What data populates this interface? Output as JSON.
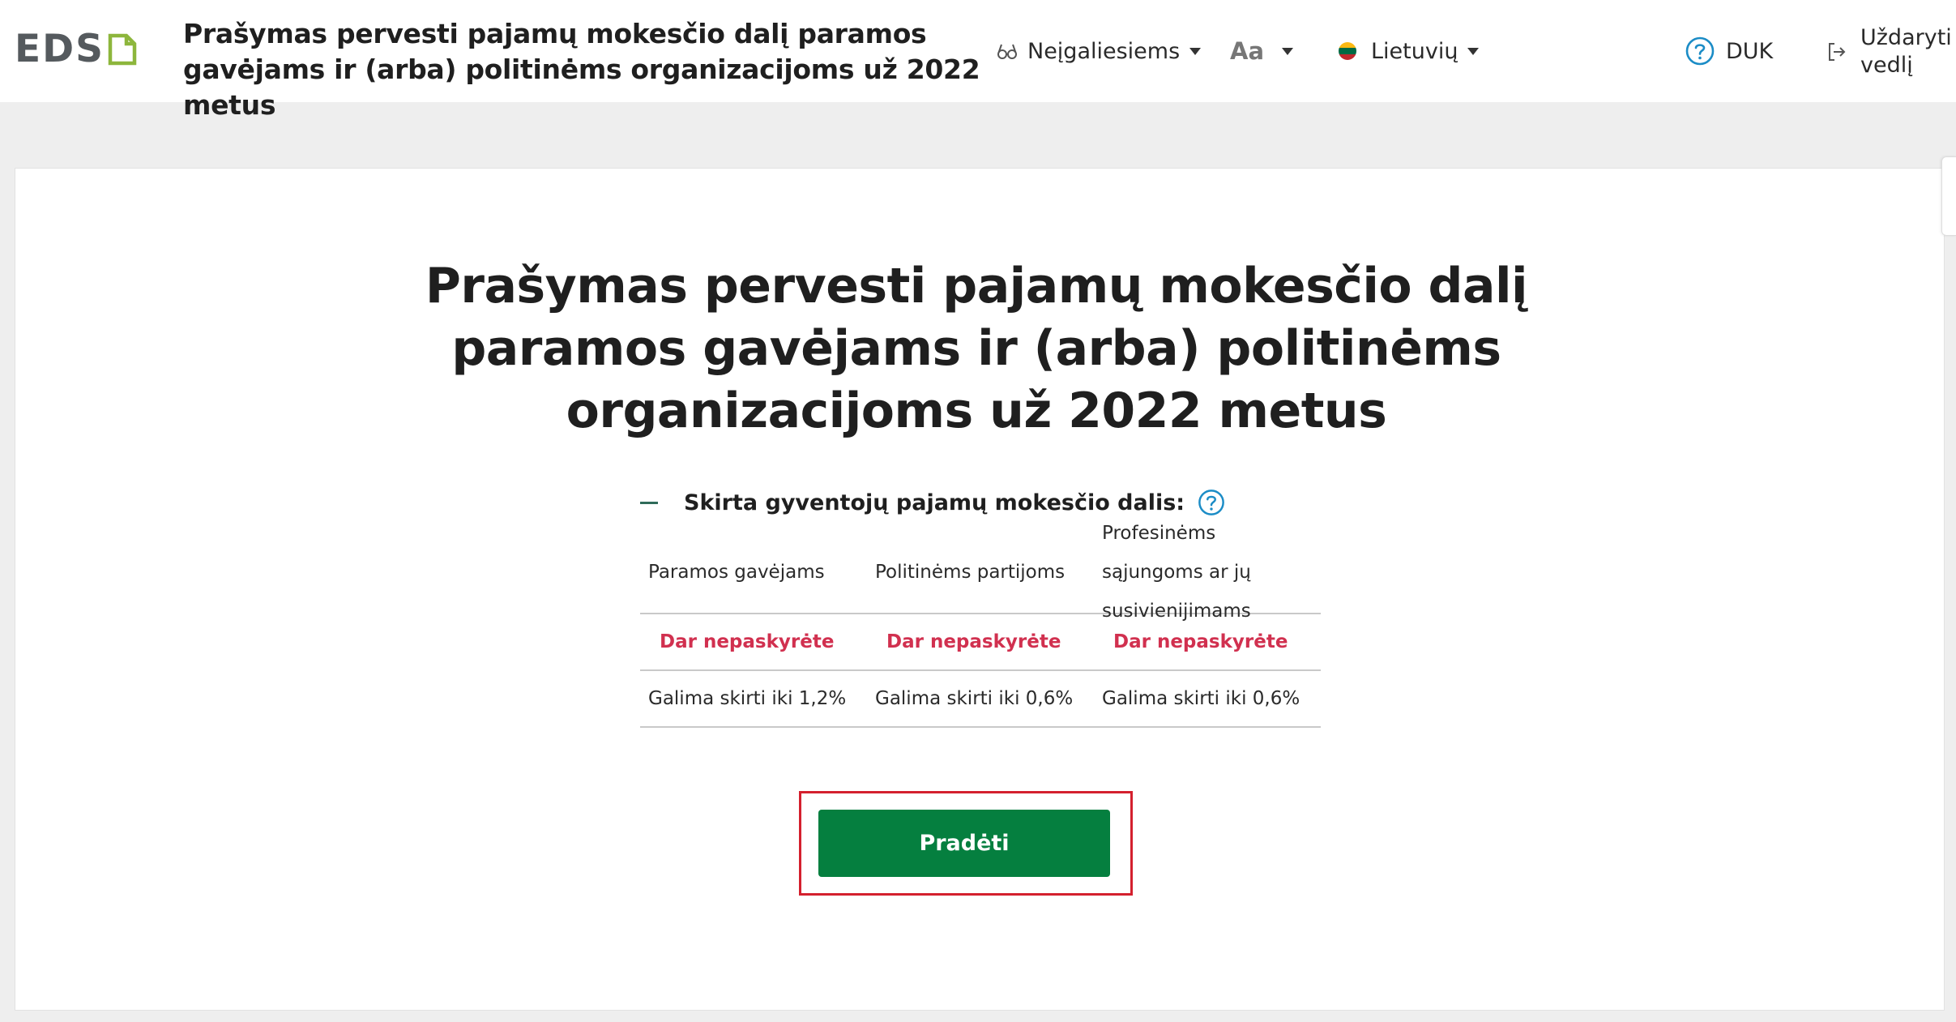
{
  "header": {
    "logo_text": "EDS",
    "title": "Prašymas pervesti pajamų mokesčio dalį paramos gavėjams ir (arba) politinėms organizacijoms už 2022 metus",
    "accessibility_label": "Neįgaliesiems",
    "font_size_label": "Aa",
    "language_label": "Lietuvių",
    "faq_label": "DUK",
    "close_label": "Uždaryti vedlį",
    "flag_colors": [
      "#fdb913",
      "#006a44",
      "#c1272d"
    ]
  },
  "main": {
    "title": "Prašymas pervesti pajamų mokesčio dalį paramos gavėjams ir (arba) politinėms organizacijoms už 2022 metus",
    "section_label": "Skirta gyventojų pajamų mokesčio dalis:",
    "columns": [
      "Paramos gavėjams",
      "Politinėms partijoms",
      "Profesinėms sąjungoms ar jų susivienijimams"
    ],
    "status_row": [
      "Dar nepaskyrėte",
      "Dar nepaskyrėte",
      "Dar nepaskyrėte"
    ],
    "limit_row": [
      "Galima skirti iki 1,2%",
      "Galima skirti iki 0,6%",
      "Galima skirti iki 0,6%"
    ],
    "start_button": "Pradėti"
  },
  "colors": {
    "accent_green": "#057f3f",
    "status_red": "#d1304f",
    "highlight_red": "#d4202e",
    "logo_green": "#8db63c"
  }
}
